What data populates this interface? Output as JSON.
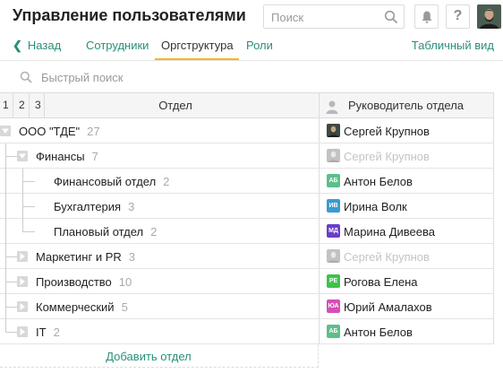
{
  "header": {
    "title": "Управление пользователями",
    "search_placeholder": "Поиск",
    "help_label": "?"
  },
  "nav": {
    "back_label": "Назад",
    "tabs": [
      {
        "label": "Сотрудники",
        "active": false
      },
      {
        "label": "Оргструктура",
        "active": true
      },
      {
        "label": "Роли",
        "active": false
      }
    ],
    "table_view_label": "Табличный вид"
  },
  "quick_search": {
    "placeholder": "Быстрый поиск"
  },
  "grid": {
    "level_headers": [
      "1",
      "2",
      "3"
    ],
    "dept_header": "Отдел",
    "manager_header": "Руководитель отдела",
    "rows": [
      {
        "name": "ООО \"ТДЕ\"",
        "count": "27",
        "manager": "Сергей Крупнов",
        "initials": "",
        "avatar_color": "#2f3a33",
        "photo": true,
        "empty": false
      },
      {
        "name": "Финансы",
        "count": "7",
        "manager": "Сергей Крупнов",
        "initials": "",
        "avatar_color": "#b8b8b8",
        "photo": true,
        "empty": true
      },
      {
        "name": "Финансовый отдел",
        "count": "2",
        "manager": "Антон Белов",
        "initials": "АБ",
        "avatar_color": "#5cbf8a",
        "photo": false,
        "empty": false
      },
      {
        "name": "Бухгалтерия",
        "count": "3",
        "manager": "Ирина Волк",
        "initials": "ИВ",
        "avatar_color": "#3a9bd1",
        "photo": false,
        "empty": false
      },
      {
        "name": "Плановый отдел",
        "count": "2",
        "manager": "Марина Дивеева",
        "initials": "МД",
        "avatar_color": "#6a3fc9",
        "photo": false,
        "empty": false
      },
      {
        "name": "Маркетинг и PR",
        "count": "3",
        "manager": "Сергей Крупнов",
        "initials": "",
        "avatar_color": "#b8b8b8",
        "photo": true,
        "empty": true
      },
      {
        "name": "Производство",
        "count": "10",
        "manager": "Рогова Елена",
        "initials": "РЕ",
        "avatar_color": "#3fc24a",
        "photo": false,
        "empty": false
      },
      {
        "name": "Коммерческий",
        "count": "5",
        "manager": "Юрий Амалахов",
        "initials": "ЮА",
        "avatar_color": "#d64fb9",
        "photo": false,
        "empty": false
      },
      {
        "name": "IT",
        "count": "2",
        "manager": "Антон Белов",
        "initials": "АБ",
        "avatar_color": "#5cbf8a",
        "photo": false,
        "empty": false
      }
    ],
    "add_label": "Добавить отдел"
  },
  "colors": {
    "accent": "#2a8f7a",
    "tab_underline": "#f5b623"
  }
}
